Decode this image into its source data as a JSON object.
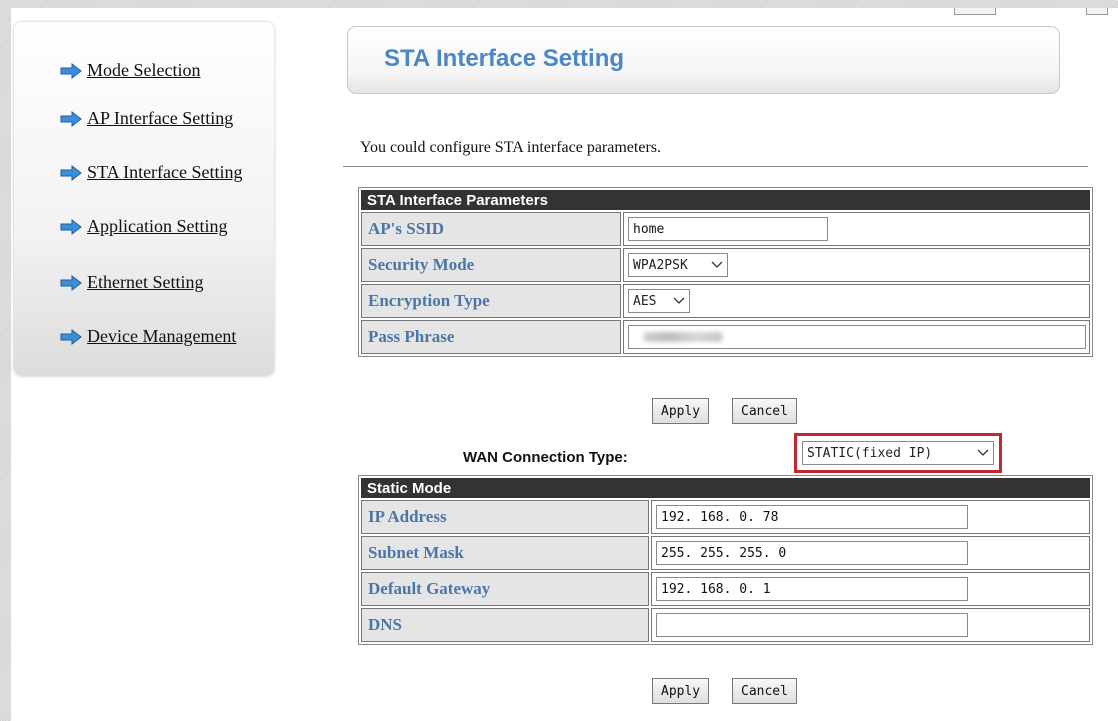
{
  "sidebar": {
    "items": [
      {
        "label": "Mode Selection"
      },
      {
        "label": "AP Interface Setting"
      },
      {
        "label": "STA Interface Setting"
      },
      {
        "label": "Application Setting"
      },
      {
        "label": "Ethernet Setting"
      },
      {
        "label": "Device Management"
      }
    ]
  },
  "header": {
    "title": "STA Interface Setting"
  },
  "description": "You could configure STA interface parameters.",
  "sta_params": {
    "heading": "STA Interface Parameters",
    "ssid_label": "AP's SSID",
    "ssid_value": "home",
    "security_label": "Security Mode",
    "security_value": "WPA2PSK",
    "encryption_label": "Encryption Type",
    "encryption_value": "AES",
    "passphrase_label": "Pass Phrase"
  },
  "buttons": {
    "apply": "Apply",
    "cancel": "Cancel"
  },
  "wan": {
    "label": "WAN Connection Type:",
    "value": "STATIC(fixed IP)",
    "highlight_color": "#c0282e"
  },
  "static_mode": {
    "heading": "Static Mode",
    "ip_label": "IP Address",
    "ip_value": "192. 168. 0. 78",
    "mask_label": "Subnet Mask",
    "mask_value": "255. 255. 255. 0",
    "gateway_label": "Default Gateway",
    "gateway_value": "192. 168. 0. 1",
    "dns_label": "DNS",
    "dns_value": ""
  },
  "colors": {
    "accent_blue": "#4b87c6",
    "label_blue": "#4a76a8",
    "table_header": "#333333",
    "arrow_blue": "#3b8fd9"
  },
  "icons": {
    "nav_arrow": "right-arrow-icon",
    "dropdown": "chevron-down-icon"
  }
}
